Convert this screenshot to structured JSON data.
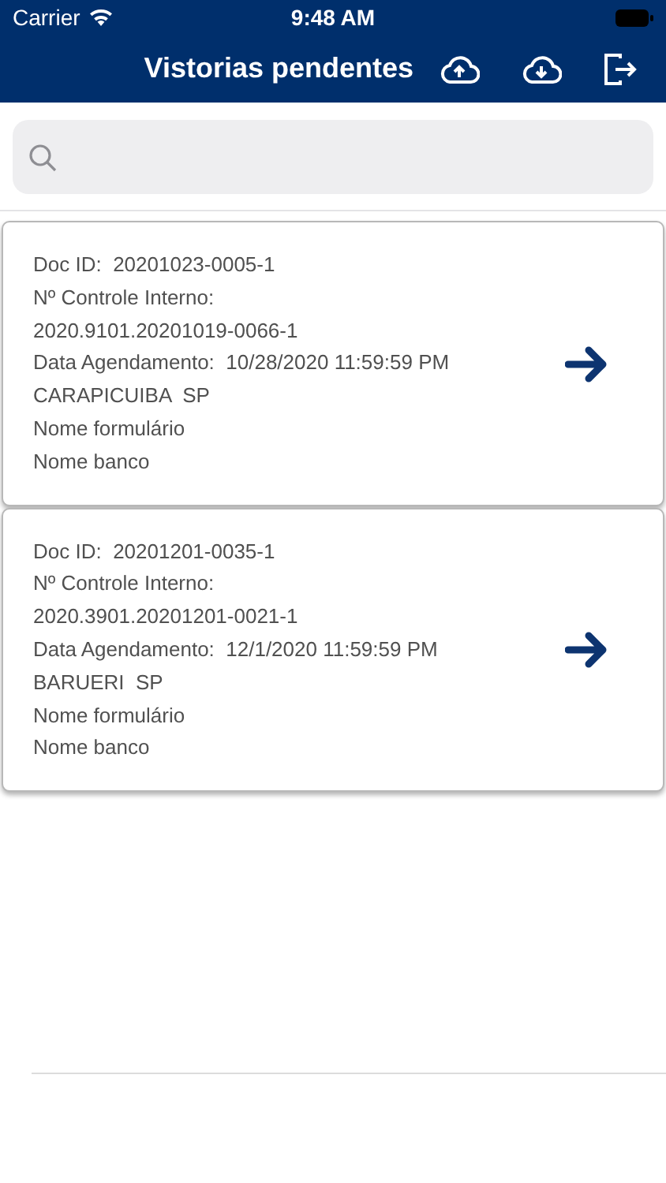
{
  "status_bar": {
    "carrier": "Carrier",
    "time": "9:48 AM"
  },
  "nav": {
    "title": "Vistorias pendentes"
  },
  "cards": [
    {
      "lines": [
        "Doc ID:  20201023-0005-1",
        "Nº Controle Interno:",
        "2020.9101.20201019-0066-1",
        "Data Agendamento:  10/28/2020 11:59:59 PM",
        "CARAPICUIBA  SP",
        "Nome formulário",
        "Nome banco"
      ]
    },
    {
      "lines": [
        "Doc ID:  20201201-0035-1",
        "Nº Controle Interno:",
        "2020.3901.20201201-0021-1",
        "Data Agendamento:  12/1/2020 11:59:59 PM",
        "BARUERI  SP",
        "Nome formulário",
        "Nome banco"
      ]
    }
  ]
}
